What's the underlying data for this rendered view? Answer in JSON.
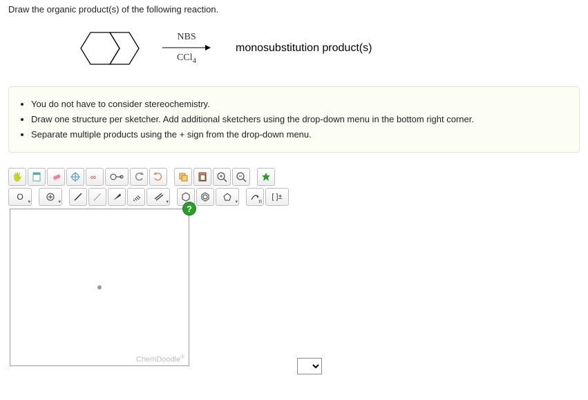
{
  "question": {
    "prompt": "Draw the organic product(s) of the following reaction."
  },
  "reaction": {
    "reagent_top": "NBS",
    "reagent_bot_base": "CCl",
    "reagent_bot_sub": "4",
    "product_label": "monosubstitution product(s)"
  },
  "hints": [
    "You do not have to consider stereochemistry.",
    "Draw one structure per sketcher. Add additional sketchers using the drop-down menu in the bottom right corner.",
    "Separate multiple products using the + sign from the drop-down menu."
  ],
  "toolbar_row1": {
    "move": "✋",
    "open": "📄",
    "erase": "✏",
    "center": "✱",
    "clean": "⚙",
    "chem": "↯",
    "undo": "↶",
    "redo": "↷",
    "copy": "⎘",
    "paste": "📋",
    "zoomin": "⊕",
    "zoomout": "⊖",
    "style": "✦"
  },
  "toolbar_row2": {
    "atom_o": "O",
    "charge": "⊕",
    "single": "—",
    "dashed": "⋯",
    "wedge": "◢",
    "hash": "⫽",
    "double": "═",
    "hex": "⬡",
    "benz": "⌬",
    "pent": "⬠",
    "curve": "⤳",
    "n_label": "n",
    "bracket": "[ ]±"
  },
  "help_label": "?",
  "watermark": "ChemDoodle",
  "watermark_sup": "®"
}
